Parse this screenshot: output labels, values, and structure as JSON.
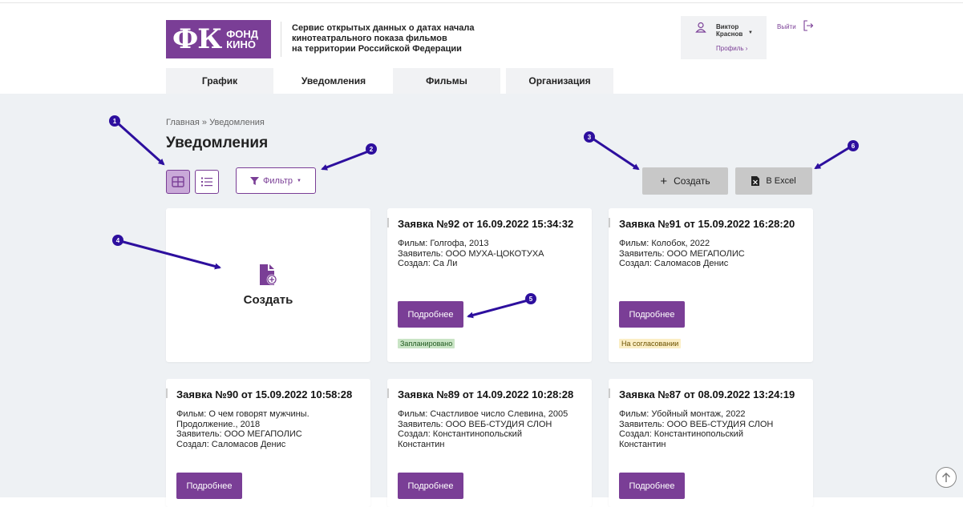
{
  "header": {
    "logo_main": "ФК",
    "logo_word1": "ФОНД",
    "logo_word2": "КИНО",
    "service_line1": "Сервис открытых данных о датах начала",
    "service_line2": "кинотеатрального показа фильмов",
    "service_line3": "на территории Российской Федерации",
    "user_first": "Виктор",
    "user_last": "Краснов",
    "profile_link": "Профиль ›",
    "logout": "Выйти"
  },
  "tabs": [
    {
      "label": "График"
    },
    {
      "label": "Уведомления"
    },
    {
      "label": "Фильмы"
    },
    {
      "label": "Организация"
    }
  ],
  "breadcrumb": "Главная » Уведомления",
  "page_title": "Уведомления",
  "toolbar": {
    "filter_label": "Фильтр",
    "create_label": "Создать",
    "excel_label": "В Excel"
  },
  "create_card_label": "Создать",
  "more_label": "Подробнее",
  "cards": [
    {
      "title": "Заявка №92 от 16.09.2022 15:34:32",
      "lines": [
        "Фильм: Голгофа, 2013",
        "Заявитель: ООО МУХА-ЦОКОТУХА",
        "Создал: Са Ли"
      ],
      "status": "Запланировано",
      "status_color": "#c9e4c5"
    },
    {
      "title": "Заявка №91 от 15.09.2022 16:28:20",
      "lines": [
        "Фильм: Колобок, 2022",
        "Заявитель: ООО МЕГАПОЛИС",
        "Создал: Саломасов Денис"
      ],
      "status": "На согласовании",
      "status_color": "#fbeec5"
    },
    {
      "title": "Заявка №90 от 15.09.2022 10:58:28",
      "lines": [
        "Фильм: О чем говорят мужчины.",
        "Продолжение., 2018",
        "Заявитель: ООО МЕГАПОЛИС",
        "Создал: Саломасов Денис"
      ],
      "status": "",
      "status_color": ""
    },
    {
      "title": "Заявка №89 от 14.09.2022 10:28:28",
      "lines": [
        "Фильм: Счастливое число Слевина, 2005",
        "Заявитель: ООО ВЕБ-СТУДИЯ СЛОН",
        "Создал: Константинопольский",
        "Константин"
      ],
      "status": "",
      "status_color": ""
    },
    {
      "title": "Заявка №87 от 08.09.2022 13:24:19",
      "lines": [
        "Фильм: Убойный монтаж, 2022",
        "Заявитель: ООО ВЕБ-СТУДИЯ СЛОН",
        "Создал: Константинопольский",
        "Константин"
      ],
      "status": "",
      "status_color": ""
    }
  ],
  "markers": [
    "1",
    "2",
    "3",
    "4",
    "5",
    "6"
  ],
  "colors": {
    "brand": "#7a3e96",
    "annotation": "#2d0f9e"
  }
}
